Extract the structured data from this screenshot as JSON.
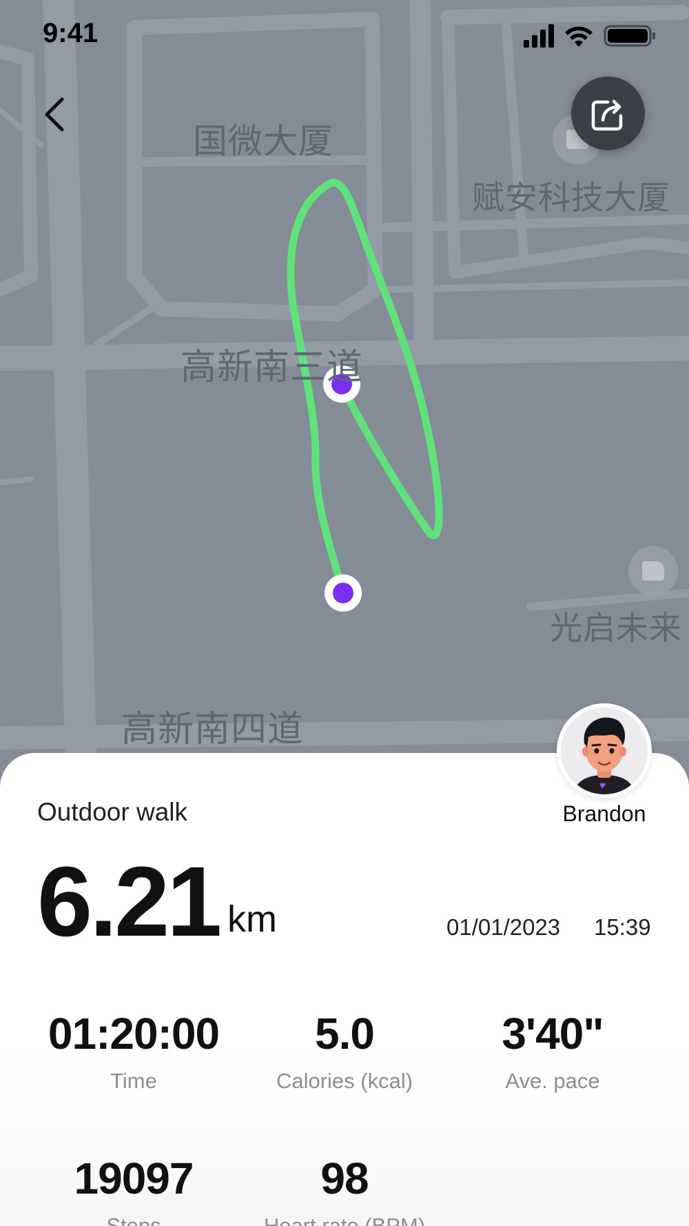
{
  "status_bar": {
    "time": "9:41"
  },
  "map": {
    "labels": {
      "guowei_building": "国微大厦",
      "fuan_building": "赋安科技大厦",
      "gaoxin_south_3rd": "高新南三道",
      "guangqi_future": "光启未来",
      "gaoxin_south_4th": "高新南四道"
    },
    "route_color": "#5fe27a",
    "marker_color": "#7b2ff0"
  },
  "activity": {
    "type": "Outdoor walk",
    "distance": "6.21",
    "distance_unit": "km",
    "date": "01/01/2023",
    "time": "15:39"
  },
  "user": {
    "name": "Brandon"
  },
  "stats": [
    {
      "value": "01:20:00",
      "label": "Time"
    },
    {
      "value": "5.0",
      "label": "Calories (kcal)"
    },
    {
      "value": "3'40\"",
      "label": "Ave. pace"
    },
    {
      "value": "19097",
      "label": "Steps"
    },
    {
      "value": "98",
      "label": "Heart rate (BPM)"
    }
  ]
}
